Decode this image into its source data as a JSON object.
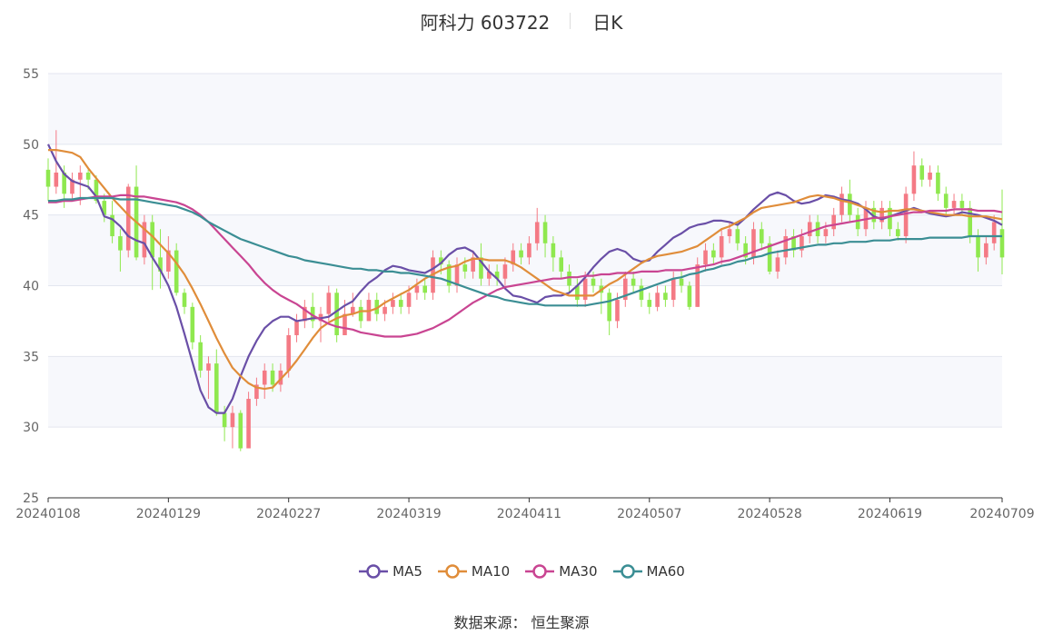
{
  "title": {
    "name": "阿科力 603722",
    "period": "日K"
  },
  "source": "数据来源： 恒生聚源",
  "chart_data": {
    "type": "candlestick",
    "ylim": [
      25,
      55
    ],
    "yticks": [
      "25",
      "30",
      "35",
      "40",
      "45",
      "50",
      "55"
    ],
    "xticks": [
      "20240108",
      "20240129",
      "20240227",
      "20240319",
      "20240411",
      "20240507",
      "20240528",
      "20240619",
      "20240709"
    ],
    "x_count": 120,
    "xtick_index": [
      0,
      15,
      30,
      45,
      60,
      75,
      90,
      105,
      119
    ],
    "colors": {
      "up": "#f47a85",
      "down": "#8fe84f"
    },
    "candles": [
      [
        48.2,
        47.0,
        49.0,
        46.0
      ],
      [
        47.0,
        48.0,
        51.0,
        46.5
      ],
      [
        48.0,
        46.5,
        48.5,
        45.5
      ],
      [
        46.5,
        47.5,
        48.0,
        46.0
      ],
      [
        47.5,
        48.0,
        48.5,
        45.7
      ],
      [
        48.0,
        47.5,
        48.2,
        46.8
      ],
      [
        47.5,
        46.0,
        47.8,
        45.8
      ],
      [
        46.0,
        45.0,
        46.5,
        44.5
      ],
      [
        45.0,
        43.5,
        46.0,
        43.0
      ],
      [
        43.5,
        42.5,
        44.0,
        41.0
      ],
      [
        42.5,
        47.0,
        47.2,
        42.0
      ],
      [
        47.0,
        42.0,
        48.5,
        41.8
      ],
      [
        42.0,
        44.5,
        45.0,
        41.5
      ],
      [
        44.5,
        42.0,
        45.0,
        39.7
      ],
      [
        42.0,
        41.0,
        44.0,
        39.8
      ],
      [
        41.0,
        42.5,
        43.5,
        40.5
      ],
      [
        42.5,
        39.5,
        43.0,
        39.3
      ],
      [
        39.5,
        38.5,
        39.8,
        38.0
      ],
      [
        38.5,
        36.0,
        38.8,
        35.5
      ],
      [
        36.0,
        34.0,
        36.5,
        33.5
      ],
      [
        34.0,
        34.5,
        35.0,
        32.0
      ],
      [
        34.5,
        31.0,
        35.5,
        30.8
      ],
      [
        31.0,
        30.0,
        31.5,
        29.0
      ],
      [
        30.0,
        31.0,
        31.5,
        28.5
      ],
      [
        31.0,
        28.5,
        31.2,
        28.3
      ],
      [
        28.5,
        32.0,
        32.5,
        28.5
      ],
      [
        32.0,
        33.0,
        33.5,
        31.5
      ],
      [
        33.0,
        34.0,
        34.5,
        32.0
      ],
      [
        34.0,
        33.0,
        34.5,
        32.5
      ],
      [
        33.0,
        34.0,
        34.5,
        32.5
      ],
      [
        34.0,
        36.5,
        37.0,
        33.5
      ],
      [
        36.5,
        37.5,
        38.0,
        36.0
      ],
      [
        37.5,
        38.5,
        39.0,
        37.0
      ],
      [
        38.5,
        37.5,
        39.5,
        37.0
      ],
      [
        37.5,
        38.0,
        38.5,
        36.0
      ],
      [
        38.0,
        39.5,
        40.0,
        37.5
      ],
      [
        39.5,
        36.5,
        39.8,
        36.0
      ],
      [
        36.5,
        38.0,
        39.0,
        36.5
      ],
      [
        38.0,
        38.5,
        39.5,
        37.8
      ],
      [
        38.5,
        37.5,
        39.0,
        37.0
      ],
      [
        37.5,
        39.0,
        39.5,
        37.5
      ],
      [
        39.0,
        38.0,
        39.5,
        37.5
      ],
      [
        38.0,
        38.5,
        39.0,
        37.5
      ],
      [
        38.5,
        39.0,
        39.5,
        38.0
      ],
      [
        39.0,
        38.5,
        39.5,
        38.0
      ],
      [
        38.5,
        39.5,
        40.0,
        38.0
      ],
      [
        39.5,
        40.0,
        40.5,
        39.0
      ],
      [
        40.0,
        39.5,
        40.5,
        39.0
      ],
      [
        39.5,
        42.0,
        42.5,
        39.0
      ],
      [
        42.0,
        41.5,
        42.5,
        40.8
      ],
      [
        41.5,
        40.0,
        41.8,
        39.5
      ],
      [
        40.0,
        41.5,
        42.0,
        39.5
      ],
      [
        41.5,
        41.0,
        42.0,
        40.5
      ],
      [
        41.0,
        42.0,
        42.5,
        40.5
      ],
      [
        42.0,
        40.5,
        43.0,
        40.0
      ],
      [
        40.5,
        41.0,
        41.5,
        40.0
      ],
      [
        41.0,
        40.5,
        41.5,
        40.0
      ],
      [
        40.5,
        41.5,
        42.0,
        40.0
      ],
      [
        41.5,
        42.5,
        43.0,
        41.0
      ],
      [
        42.5,
        42.0,
        43.0,
        41.5
      ],
      [
        42.0,
        43.0,
        43.5,
        41.5
      ],
      [
        43.0,
        44.5,
        45.5,
        42.5
      ],
      [
        44.5,
        43.0,
        45.0,
        42.0
      ],
      [
        43.0,
        42.0,
        43.5,
        41.0
      ],
      [
        42.0,
        41.0,
        42.5,
        40.5
      ],
      [
        41.0,
        40.0,
        41.5,
        39.5
      ],
      [
        40.0,
        39.0,
        40.5,
        38.5
      ],
      [
        39.0,
        40.5,
        41.0,
        38.5
      ],
      [
        40.5,
        40.0,
        41.0,
        39.5
      ],
      [
        40.0,
        39.5,
        40.5,
        38.0
      ],
      [
        39.5,
        37.5,
        39.8,
        36.5
      ],
      [
        37.5,
        39.0,
        39.5,
        37.0
      ],
      [
        39.0,
        40.5,
        41.0,
        38.5
      ],
      [
        40.5,
        40.0,
        41.0,
        39.5
      ],
      [
        40.0,
        39.0,
        40.5,
        38.5
      ],
      [
        39.0,
        38.5,
        39.5,
        38.0
      ],
      [
        38.5,
        39.5,
        40.0,
        38.2
      ],
      [
        39.5,
        39.0,
        40.0,
        38.5
      ],
      [
        39.0,
        40.5,
        41.0,
        38.5
      ],
      [
        40.5,
        40.0,
        41.0,
        39.5
      ],
      [
        40.0,
        38.5,
        40.3,
        38.3
      ],
      [
        38.5,
        41.5,
        42.0,
        38.5
      ],
      [
        41.5,
        42.5,
        43.0,
        41.0
      ],
      [
        42.5,
        42.0,
        43.0,
        41.5
      ],
      [
        42.0,
        43.5,
        44.0,
        41.5
      ],
      [
        43.5,
        44.0,
        44.5,
        43.0
      ],
      [
        44.0,
        43.0,
        44.5,
        42.5
      ],
      [
        43.0,
        42.0,
        43.5,
        41.5
      ],
      [
        42.0,
        44.0,
        44.5,
        41.5
      ],
      [
        44.0,
        43.0,
        44.5,
        42.5
      ],
      [
        43.0,
        41.0,
        43.5,
        40.8
      ],
      [
        41.0,
        42.0,
        42.5,
        40.5
      ],
      [
        42.0,
        43.5,
        44.0,
        41.5
      ],
      [
        43.5,
        42.5,
        44.0,
        42.0
      ],
      [
        42.5,
        43.5,
        44.0,
        42.0
      ],
      [
        43.5,
        44.5,
        45.0,
        43.0
      ],
      [
        44.5,
        43.5,
        45.0,
        43.0
      ],
      [
        43.5,
        44.0,
        44.5,
        43.0
      ],
      [
        44.0,
        45.0,
        45.5,
        43.5
      ],
      [
        45.0,
        46.5,
        47.0,
        44.5
      ],
      [
        46.5,
        45.0,
        47.5,
        44.5
      ],
      [
        45.0,
        44.0,
        45.5,
        43.5
      ],
      [
        44.0,
        45.5,
        46.0,
        43.5
      ],
      [
        45.5,
        44.5,
        46.0,
        44.0
      ],
      [
        44.5,
        45.5,
        46.0,
        44.0
      ],
      [
        45.5,
        44.0,
        46.0,
        43.5
      ],
      [
        44.0,
        43.5,
        44.5,
        43.2
      ],
      [
        43.5,
        46.5,
        47.0,
        43.0
      ],
      [
        46.5,
        48.5,
        49.5,
        46.0
      ],
      [
        48.5,
        47.5,
        49.0,
        47.0
      ],
      [
        47.5,
        48.0,
        48.5,
        47.0
      ],
      [
        48.0,
        46.5,
        48.5,
        46.0
      ],
      [
        46.5,
        45.5,
        47.0,
        45.0
      ],
      [
        45.5,
        46.0,
        46.5,
        45.0
      ],
      [
        46.0,
        45.5,
        46.5,
        45.0
      ],
      [
        45.5,
        43.5,
        46.0,
        43.0
      ],
      [
        43.5,
        42.0,
        44.0,
        41.0
      ],
      [
        42.0,
        43.0,
        43.5,
        41.5
      ],
      [
        43.0,
        44.5,
        45.0,
        42.5
      ],
      [
        44.0,
        42.0,
        46.8,
        40.8
      ]
    ],
    "series": [
      {
        "name": "MA5",
        "color": "#6a4fa7",
        "values": [
          50.0,
          48.8,
          47.9,
          47.4,
          47.2,
          47.0,
          46.3,
          44.9,
          44.7,
          44.2,
          43.5,
          43.2,
          43.0,
          42.0,
          41.1,
          40.0,
          38.5,
          36.6,
          34.6,
          32.6,
          31.4,
          31.0,
          31.0,
          32.0,
          33.6,
          35.0,
          36.1,
          37.0,
          37.5,
          37.8,
          37.8,
          37.5,
          37.6,
          37.7,
          37.7,
          37.8,
          38.2,
          38.6,
          38.9,
          39.6,
          40.2,
          40.6,
          41.1,
          41.4,
          41.3,
          41.1,
          41.0,
          40.9,
          41.2,
          41.6,
          42.2,
          42.6,
          42.7,
          42.4,
          41.7,
          41.0,
          40.5,
          39.8,
          39.3,
          39.2,
          39.0,
          38.8,
          39.2,
          39.3,
          39.3,
          39.5,
          40.0,
          40.6,
          41.3,
          41.9,
          42.4,
          42.6,
          42.4,
          41.9,
          41.7,
          41.8,
          42.4,
          42.9,
          43.4,
          43.7,
          44.1,
          44.3,
          44.4,
          44.6,
          44.6,
          44.5,
          44.3,
          44.8,
          45.4,
          45.9,
          46.4,
          46.6,
          46.4,
          46.0,
          45.8,
          45.9,
          46.1,
          46.4,
          46.3,
          46.1,
          46.0,
          45.8,
          45.4,
          44.9,
          44.7,
          44.9,
          45.1,
          45.3,
          45.5,
          45.3,
          45.1,
          45.0,
          44.9,
          45.0,
          45.2,
          45.1,
          45.0,
          44.8,
          44.6,
          44.3
        ]
      },
      {
        "name": "MA10",
        "color": "#e08d3a",
        "values": [
          49.6,
          49.6,
          49.5,
          49.4,
          49.1,
          48.3,
          47.6,
          46.9,
          46.2,
          45.6,
          45.0,
          44.5,
          44.0,
          43.5,
          42.9,
          42.3,
          41.6,
          40.8,
          39.8,
          38.7,
          37.5,
          36.3,
          35.2,
          34.2,
          33.6,
          33.1,
          32.8,
          32.7,
          32.8,
          33.4,
          34.0,
          34.7,
          35.5,
          36.3,
          37.0,
          37.4,
          37.7,
          37.9,
          38.0,
          38.2,
          38.2,
          38.4,
          38.8,
          39.1,
          39.4,
          39.7,
          40.1,
          40.5,
          40.8,
          41.1,
          41.3,
          41.4,
          41.7,
          41.9,
          41.9,
          41.8,
          41.8,
          41.8,
          41.6,
          41.3,
          40.9,
          40.5,
          40.1,
          39.7,
          39.5,
          39.3,
          39.3,
          39.3,
          39.3,
          39.7,
          40.1,
          40.4,
          40.8,
          41.2,
          41.6,
          41.9,
          42.1,
          42.2,
          42.3,
          42.4,
          42.6,
          42.8,
          43.2,
          43.6,
          44.0,
          44.2,
          44.5,
          44.8,
          45.2,
          45.5,
          45.6,
          45.7,
          45.8,
          45.9,
          46.1,
          46.3,
          46.4,
          46.3,
          46.2,
          46.0,
          45.9,
          45.7,
          45.5,
          45.3,
          45.2,
          45.3,
          45.3,
          45.4,
          45.4,
          45.3,
          45.2,
          45.1,
          45.0,
          45.0,
          45.0,
          44.9,
          44.9,
          44.9,
          44.8,
          44.7
        ]
      },
      {
        "name": "MA30",
        "color": "#c94592",
        "values": [
          45.9,
          45.9,
          46.0,
          46.0,
          46.1,
          46.2,
          46.3,
          46.3,
          46.3,
          46.4,
          46.4,
          46.3,
          46.3,
          46.2,
          46.1,
          46.0,
          45.9,
          45.7,
          45.4,
          45.0,
          44.5,
          43.9,
          43.3,
          42.7,
          42.1,
          41.5,
          40.8,
          40.2,
          39.7,
          39.3,
          39.0,
          38.7,
          38.3,
          37.9,
          37.6,
          37.3,
          37.1,
          37.0,
          36.9,
          36.7,
          36.6,
          36.5,
          36.4,
          36.4,
          36.4,
          36.5,
          36.6,
          36.8,
          37.0,
          37.3,
          37.6,
          38.0,
          38.4,
          38.8,
          39.1,
          39.4,
          39.7,
          39.9,
          40.0,
          40.1,
          40.2,
          40.3,
          40.4,
          40.5,
          40.5,
          40.6,
          40.6,
          40.7,
          40.7,
          40.8,
          40.8,
          40.9,
          40.9,
          40.9,
          41.0,
          41.0,
          41.0,
          41.1,
          41.1,
          41.1,
          41.2,
          41.3,
          41.4,
          41.5,
          41.7,
          41.8,
          42.0,
          42.2,
          42.4,
          42.6,
          42.8,
          43.0,
          43.2,
          43.4,
          43.6,
          43.8,
          44.0,
          44.2,
          44.3,
          44.4,
          44.5,
          44.6,
          44.7,
          44.8,
          44.8,
          44.9,
          45.0,
          45.1,
          45.2,
          45.2,
          45.3,
          45.3,
          45.3,
          45.4,
          45.4,
          45.4,
          45.3,
          45.3,
          45.3,
          45.2
        ]
      },
      {
        "name": "MA60",
        "color": "#3b8e94",
        "values": [
          46.0,
          46.0,
          46.1,
          46.1,
          46.2,
          46.2,
          46.2,
          46.2,
          46.2,
          46.1,
          46.1,
          46.1,
          46.0,
          45.9,
          45.8,
          45.7,
          45.6,
          45.4,
          45.2,
          44.9,
          44.5,
          44.2,
          43.9,
          43.6,
          43.3,
          43.1,
          42.9,
          42.7,
          42.5,
          42.3,
          42.1,
          42.0,
          41.8,
          41.7,
          41.6,
          41.5,
          41.4,
          41.3,
          41.2,
          41.2,
          41.1,
          41.1,
          41.0,
          41.0,
          40.9,
          40.9,
          40.8,
          40.7,
          40.6,
          40.5,
          40.3,
          40.1,
          39.9,
          39.7,
          39.5,
          39.3,
          39.2,
          39.0,
          38.9,
          38.8,
          38.7,
          38.7,
          38.6,
          38.6,
          38.6,
          38.6,
          38.6,
          38.6,
          38.7,
          38.8,
          38.9,
          39.1,
          39.3,
          39.5,
          39.7,
          39.9,
          40.1,
          40.3,
          40.5,
          40.6,
          40.8,
          40.9,
          41.1,
          41.2,
          41.4,
          41.5,
          41.7,
          41.8,
          42.0,
          42.1,
          42.3,
          42.4,
          42.5,
          42.6,
          42.7,
          42.8,
          42.9,
          42.9,
          43.0,
          43.0,
          43.1,
          43.1,
          43.1,
          43.2,
          43.2,
          43.2,
          43.3,
          43.3,
          43.3,
          43.3,
          43.4,
          43.4,
          43.4,
          43.4,
          43.4,
          43.5,
          43.5,
          43.5,
          43.5,
          43.5
        ]
      }
    ]
  }
}
